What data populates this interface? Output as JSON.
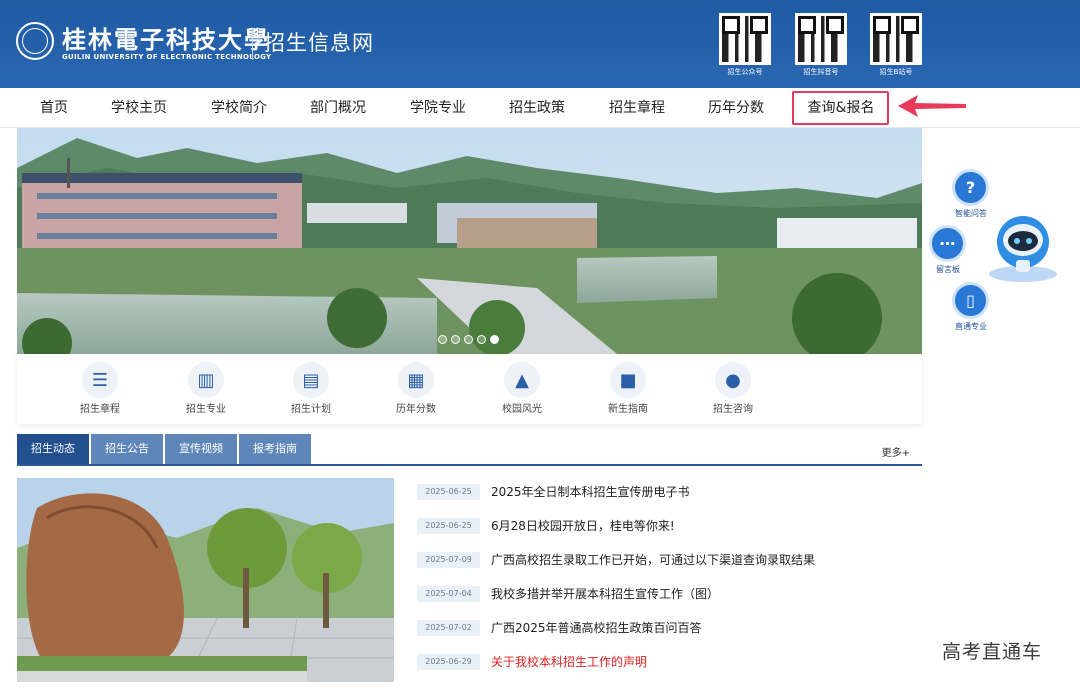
{
  "header": {
    "school_name_cn": "桂林電子科技大學",
    "school_name_en": "GUILIN UNIVERSITY OF ELECTRONIC TECHNOLOGY",
    "site_title": "招生信息网",
    "qr_codes": [
      {
        "label": "招生公众号"
      },
      {
        "label": "招生抖音号"
      },
      {
        "label": "招生B站号"
      }
    ]
  },
  "nav": {
    "items": [
      "首页",
      "学校主页",
      "学校简介",
      "部门概况",
      "学院专业",
      "招生政策",
      "招生章程",
      "历年分数",
      "查询&报名"
    ],
    "highlighted": "查询&报名",
    "highlight_color": "#e83a5a"
  },
  "banner": {
    "slides_total": 5,
    "active_slide": 5
  },
  "quick_links": [
    {
      "label": "招生章程",
      "icon": "document-icon"
    },
    {
      "label": "招生专业",
      "icon": "book-icon"
    },
    {
      "label": "招生计划",
      "icon": "clipboard-icon"
    },
    {
      "label": "历年分数",
      "icon": "chart-icon"
    },
    {
      "label": "校园风光",
      "icon": "landscape-icon"
    },
    {
      "label": "新生指南",
      "icon": "guide-icon"
    },
    {
      "label": "招生咨询",
      "icon": "headset-icon"
    }
  ],
  "side_tools": [
    {
      "label": "智能问答",
      "icon": "question-icon"
    },
    {
      "label": "留言板",
      "icon": "chat-icon"
    },
    {
      "label": "直通专业",
      "icon": "book-icon"
    }
  ],
  "tabs": {
    "items": [
      "招生动态",
      "招生公告",
      "宣传视频",
      "报考指南"
    ],
    "active": "招生动态",
    "more": "更多+"
  },
  "news": [
    {
      "date": "2025-06-25",
      "title": "2025年全日制本科招生宣传册电子书",
      "highlight": false
    },
    {
      "date": "2025-06-25",
      "title": "6月28日校园开放日，桂电等你来!",
      "highlight": false
    },
    {
      "date": "2025-07-09",
      "title": "广西高校招生录取工作已开始，可通过以下渠道查询录取结果",
      "highlight": false
    },
    {
      "date": "2025-07-04",
      "title": "我校多措并举开展本科招生宣传工作（图）",
      "highlight": false
    },
    {
      "date": "2025-07-02",
      "title": "广西2025年普通高校招生政策百问百答",
      "highlight": false
    },
    {
      "date": "2025-06-29",
      "title": "关于我校本科招生工作的声明",
      "highlight": true
    }
  ],
  "watermark": "高考直通车",
  "colors": {
    "header_blue": "#2a67b2",
    "tab_active": "#22508f",
    "tab_inactive": "#5f86b8",
    "alert_red": "#e02020"
  }
}
